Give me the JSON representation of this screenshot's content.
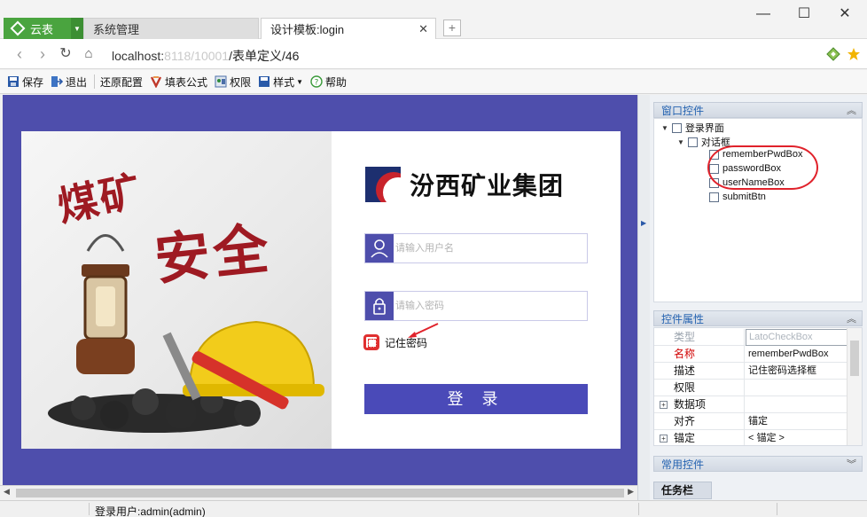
{
  "browser": {
    "app_tab": "云表",
    "tabs": [
      {
        "label": "系统管理",
        "active": false
      },
      {
        "label": "设计模板:login",
        "active": true
      }
    ],
    "url_host": "localhost:",
    "url_port_blur": "8118/10001",
    "url_path": "/表单定义/46"
  },
  "toolbar": {
    "save": "保存",
    "exit": "退出",
    "restore": "还原配置",
    "formula": "填表公式",
    "permission": "权限",
    "style": "样式",
    "help": "帮助"
  },
  "login_form": {
    "banner_line1": "煤矿",
    "banner_line2": "安全",
    "company_name": "汾西矿业集团",
    "username_placeholder": "请输入用户名",
    "password_placeholder": "请输入密码",
    "remember_label": "记住密码",
    "login_button": "登 录"
  },
  "window_controls": {
    "panel_title": "窗口控件",
    "tree": [
      {
        "label": "登录界面",
        "level": 0
      },
      {
        "label": "对话框",
        "level": 1
      },
      {
        "label": "rememberPwdBox",
        "level": 2
      },
      {
        "label": "passwordBox",
        "level": 2
      },
      {
        "label": "userNameBox",
        "level": 2
      },
      {
        "label": "submitBtn",
        "level": 2
      }
    ]
  },
  "properties": {
    "panel_title": "控件属性",
    "rows": [
      {
        "key": "类型",
        "value": "LatoCheckBox"
      },
      {
        "key": "名称",
        "value": "rememberPwdBox"
      },
      {
        "key": "描述",
        "value": "记住密码选择框"
      },
      {
        "key": "权限",
        "value": ""
      },
      {
        "key": "数据项",
        "value": ""
      },
      {
        "key": "对齐",
        "value": "锚定"
      },
      {
        "key": "锚定",
        "value": "< 锚定 >"
      }
    ]
  },
  "common_controls": {
    "panel_title": "常用控件"
  },
  "taskbar": {
    "label": "任务栏"
  },
  "status": {
    "user": "登录用户:admin(admin)"
  },
  "colors": {
    "app_green": "#4aa43f",
    "canvas_bg": "#4e4eac",
    "login_button": "#4a4ab8",
    "highlight_red": "#e0222b",
    "panel_title": "#2462b0"
  }
}
